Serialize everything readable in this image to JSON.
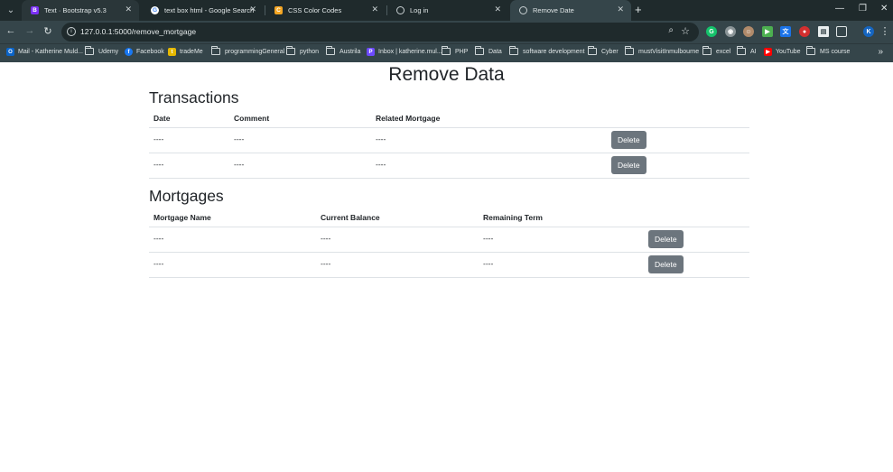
{
  "browser": {
    "tabs": [
      {
        "title": "Text · Bootstrap v5.3",
        "icon": "bootstrap-icon"
      },
      {
        "title": "text box html - Google Search",
        "icon": "google-icon"
      },
      {
        "title": "CSS Color Codes",
        "icon": "csscolors-icon"
      },
      {
        "title": "Log in",
        "icon": "globe-icon"
      },
      {
        "title": "Remove Date",
        "icon": "globe-icon"
      }
    ],
    "new_tab": "+",
    "controls": {
      "minimize": "—",
      "restore": "❐",
      "close": "✕"
    },
    "url": "127.0.0.1:5000/remove_mortgage",
    "profile_initial": "K",
    "bookmarks": [
      {
        "label": "Mail - Katherine Muld...",
        "icon": "outlook-icon"
      },
      {
        "label": "Udemy",
        "icon": "folder-icon"
      },
      {
        "label": "Facebook",
        "icon": "facebook-icon"
      },
      {
        "label": "tradeMe",
        "icon": "trademe-icon"
      },
      {
        "label": "programmingGeneral",
        "icon": "folder-icon"
      },
      {
        "label": "python",
        "icon": "folder-icon"
      },
      {
        "label": "Austrila",
        "icon": "folder-icon"
      },
      {
        "label": "Inbox | katherine.mul...",
        "icon": "proton-icon"
      },
      {
        "label": "PHP",
        "icon": "folder-icon"
      },
      {
        "label": "Data",
        "icon": "folder-icon"
      },
      {
        "label": "software development",
        "icon": "folder-icon"
      },
      {
        "label": "Cyber",
        "icon": "folder-icon"
      },
      {
        "label": "mustVisitInmulbourne",
        "icon": "folder-icon"
      },
      {
        "label": "excel",
        "icon": "folder-icon"
      },
      {
        "label": "AI",
        "icon": "folder-icon"
      },
      {
        "label": "YouTube",
        "icon": "youtube-icon"
      },
      {
        "label": "MS course",
        "icon": "folder-icon"
      }
    ]
  },
  "page": {
    "title": "Remove Data",
    "transactions": {
      "heading": "Transactions",
      "columns": [
        "Date",
        "Comment",
        "Related Mortgage"
      ],
      "rows": [
        [
          "----",
          "----",
          "----"
        ],
        [
          "----",
          "----",
          "----"
        ]
      ],
      "delete_label": "Delete"
    },
    "mortgages": {
      "heading": "Mortgages",
      "columns": [
        "Mortgage Name",
        "Current Balance",
        "Remaining Term"
      ],
      "rows": [
        [
          "----",
          "----",
          "----"
        ],
        [
          "----",
          "----",
          "----"
        ]
      ],
      "delete_label": "Delete"
    }
  },
  "colors": {
    "chrome_dark": "#1f2a2c",
    "chrome_toolbar": "#35454a",
    "button_secondary": "#6c757d",
    "text": "#212529"
  }
}
